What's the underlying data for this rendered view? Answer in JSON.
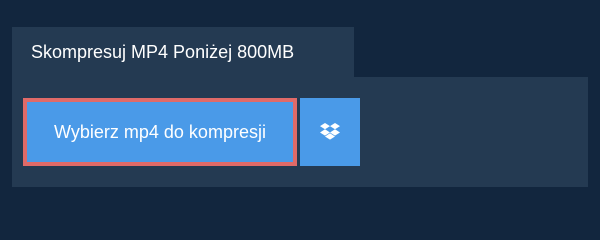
{
  "tab": {
    "title": "Skompresuj MP4 Poniżej 800MB"
  },
  "upload": {
    "button_label": "Wybierz mp4 do kompresji"
  },
  "dropbox": {
    "icon": "dropbox-icon"
  },
  "colors": {
    "page_background": "#12263e",
    "panel_background": "#243a52",
    "button_background": "#4a9ae8",
    "highlight_border": "#e06a68",
    "text": "#ffffff"
  }
}
